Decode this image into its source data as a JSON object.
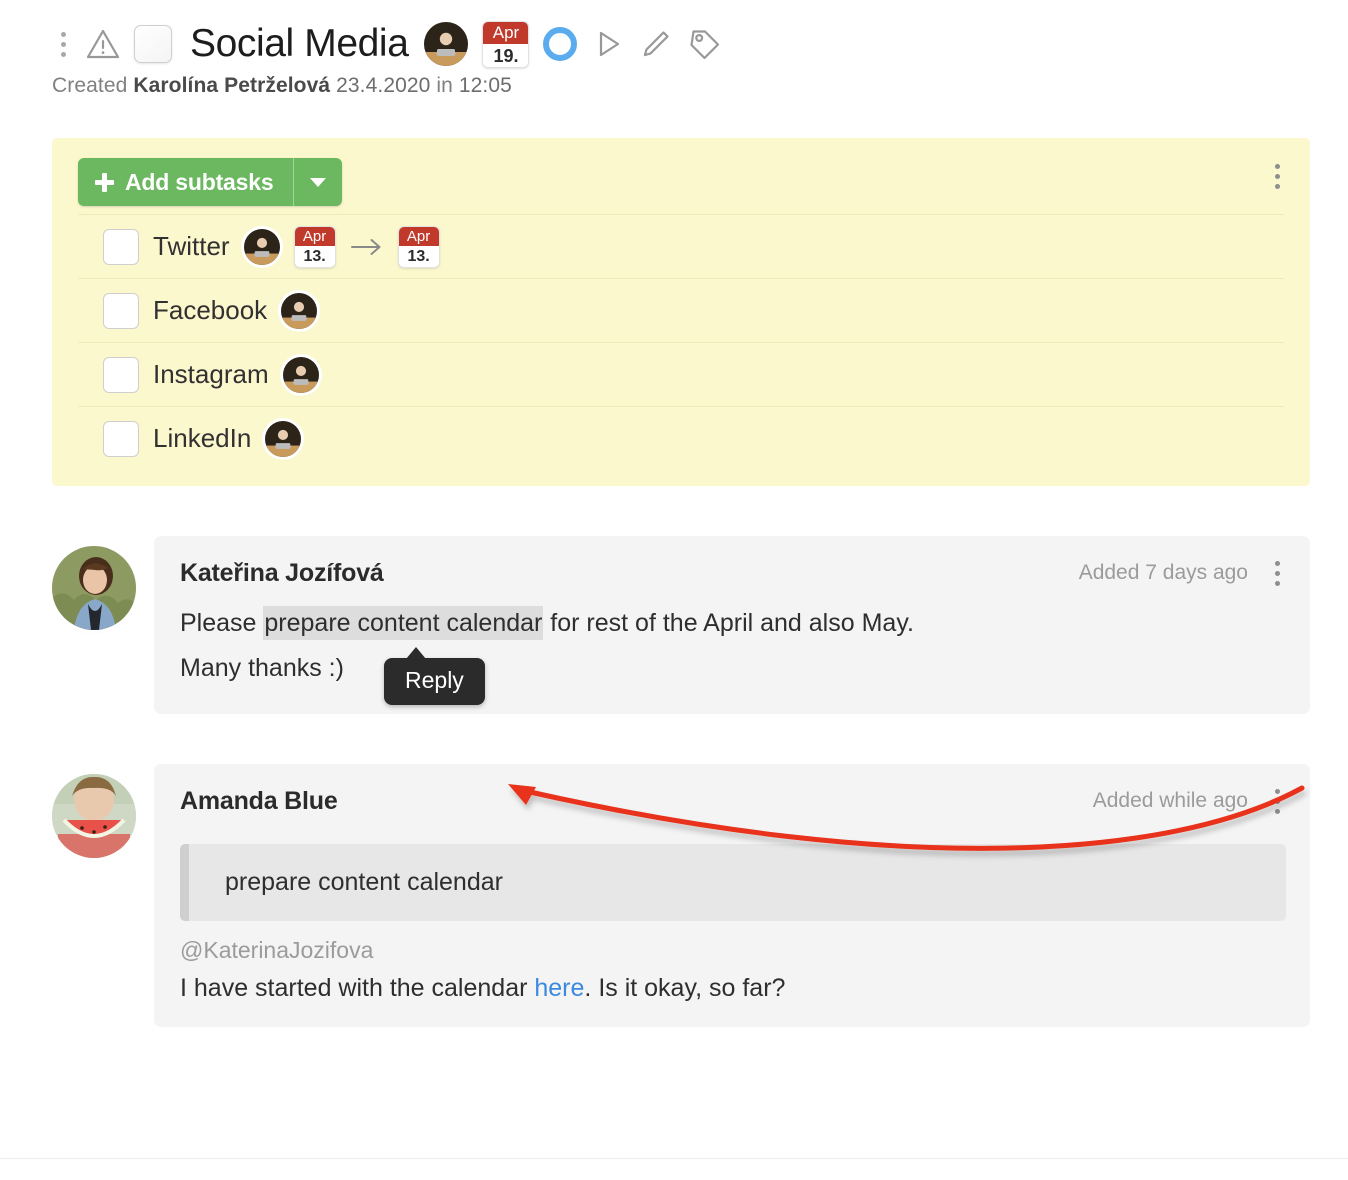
{
  "header": {
    "menu_icon": "dots-vertical-icon",
    "warning_icon": "warning-triangle-icon",
    "checkbox_name": "task-complete-checkbox",
    "title": "Social Media",
    "assignee_avatar": "assignee-avatar",
    "due_badge": {
      "month": "Apr",
      "day": "19."
    },
    "status_icon": "circle-ring-icon",
    "play_icon": "play-triangle-icon",
    "edit_icon": "pencil-icon",
    "tag_icon": "tag-icon"
  },
  "created": {
    "prefix": "Created",
    "author": "Karolína Petrželová",
    "date": "23.4.2020",
    "in_word": "in",
    "time": "12:05"
  },
  "subtasks_panel": {
    "add_button_label": "Add subtasks",
    "add_button_icon": "plus-icon",
    "dropdown_icon": "chevron-down-icon",
    "panel_menu_icon": "dots-vertical-icon",
    "background_color": "#fcf8ce",
    "button_color": "#6cb860",
    "items": [
      {
        "label": "Twitter",
        "has_avatar": true,
        "date_from": {
          "month": "Apr",
          "day": "13."
        },
        "date_to": {
          "month": "Apr",
          "day": "13."
        },
        "arrow_icon": "arrow-right-icon"
      },
      {
        "label": "Facebook",
        "has_avatar": true
      },
      {
        "label": "Instagram",
        "has_avatar": true
      },
      {
        "label": "LinkedIn",
        "has_avatar": true
      }
    ]
  },
  "comments": [
    {
      "author": "Kateřina Jozífová",
      "meta": "Added 7 days ago",
      "menu_icon": "dots-vertical-icon",
      "avatar_name": "avatar-katerina-jozifova",
      "line1_pre": "Please ",
      "line1_highlight": "prepare content calendar",
      "line1_post": " for rest of the April and also May.",
      "line2": "Many thanks :)",
      "tooltip": "Reply"
    },
    {
      "author": "Amanda Blue",
      "meta": "Added while ago",
      "menu_icon": "dots-vertical-icon",
      "avatar_name": "avatar-amanda-blue",
      "quote": "prepare content calendar",
      "mention": "@KaterinaJozifova",
      "reply_pre": "I have started with the calendar ",
      "reply_link": "here",
      "reply_post": ". Is it okay, so far?"
    }
  ],
  "annotation": {
    "arrow_color": "#e8321a",
    "name": "red-annotation-arrow"
  }
}
